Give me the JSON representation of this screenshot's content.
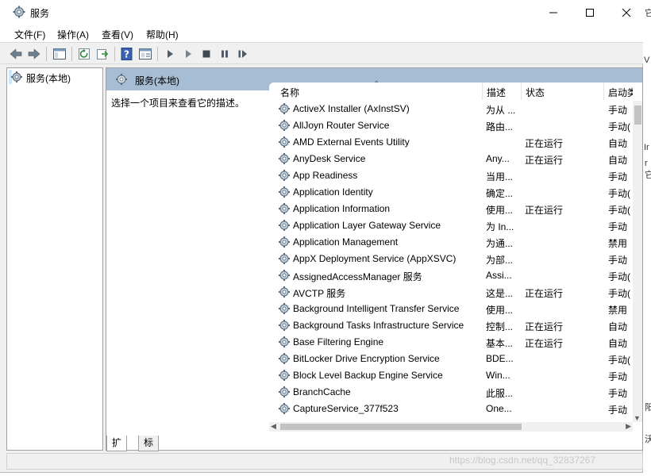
{
  "window": {
    "title": "服务"
  },
  "window_controls": {
    "minimize": "—",
    "maximize": "☐",
    "close": "✕"
  },
  "menu": [
    "文件(F)",
    "操作(A)",
    "查看(V)",
    "帮助(H)"
  ],
  "toolbar_icons": [
    "back-arrow-icon",
    "forward-arrow-icon",
    "show-hide-tree-icon",
    "refresh-icon",
    "export-list-icon",
    "help-icon",
    "properties-icon",
    "start-service-icon",
    "start-service-params-icon",
    "stop-service-icon",
    "pause-service-icon",
    "restart-service-icon"
  ],
  "tree": {
    "root_label": "服务(本地)"
  },
  "detail": {
    "header_label": "服务(本地)",
    "description_hint": "选择一个项目来查看它的描述。"
  },
  "columns": {
    "name": "名称",
    "description": "描述",
    "status": "状态",
    "startup": "启动类"
  },
  "sort_indicator": "⌃",
  "services": [
    {
      "name": "ActiveX Installer (AxInstSV)",
      "desc": "为从 ...",
      "status": "",
      "startup": "手动"
    },
    {
      "name": "AllJoyn Router Service",
      "desc": "路由...",
      "status": "",
      "startup": "手动("
    },
    {
      "name": "AMD External Events Utility",
      "desc": "",
      "status": "正在运行",
      "startup": "自动"
    },
    {
      "name": "AnyDesk Service",
      "desc": "Any...",
      "status": "正在运行",
      "startup": "自动"
    },
    {
      "name": "App Readiness",
      "desc": "当用...",
      "status": "",
      "startup": "手动"
    },
    {
      "name": "Application Identity",
      "desc": "确定...",
      "status": "",
      "startup": "手动("
    },
    {
      "name": "Application Information",
      "desc": "使用...",
      "status": "正在运行",
      "startup": "手动("
    },
    {
      "name": "Application Layer Gateway Service",
      "desc": "为 In...",
      "status": "",
      "startup": "手动"
    },
    {
      "name": "Application Management",
      "desc": "为通...",
      "status": "",
      "startup": "禁用"
    },
    {
      "name": "AppX Deployment Service (AppXSVC)",
      "desc": "为部...",
      "status": "",
      "startup": "手动"
    },
    {
      "name": "AssignedAccessManager 服务",
      "desc": "Assi...",
      "status": "",
      "startup": "手动("
    },
    {
      "name": "AVCTP 服务",
      "desc": "这是...",
      "status": "正在运行",
      "startup": "手动("
    },
    {
      "name": "Background Intelligent Transfer Service",
      "desc": "使用...",
      "status": "",
      "startup": "禁用"
    },
    {
      "name": "Background Tasks Infrastructure Service",
      "desc": "控制...",
      "status": "正在运行",
      "startup": "自动"
    },
    {
      "name": "Base Filtering Engine",
      "desc": "基本...",
      "status": "正在运行",
      "startup": "自动"
    },
    {
      "name": "BitLocker Drive Encryption Service",
      "desc": "BDE...",
      "status": "",
      "startup": "手动("
    },
    {
      "name": "Block Level Backup Engine Service",
      "desc": "Win...",
      "status": "",
      "startup": "手动"
    },
    {
      "name": "BranchCache",
      "desc": "此服...",
      "status": "",
      "startup": "手动"
    },
    {
      "name": "CaptureService_377f523",
      "desc": "One...",
      "status": "",
      "startup": "手动"
    }
  ],
  "tabs": [
    "扩展",
    "标准"
  ],
  "watermark": "https://blog.csdn.net/qq_32837267",
  "background_glyphs": [
    "它",
    "V",
    "Ir",
    "r",
    "它",
    "阳",
    "沃"
  ]
}
